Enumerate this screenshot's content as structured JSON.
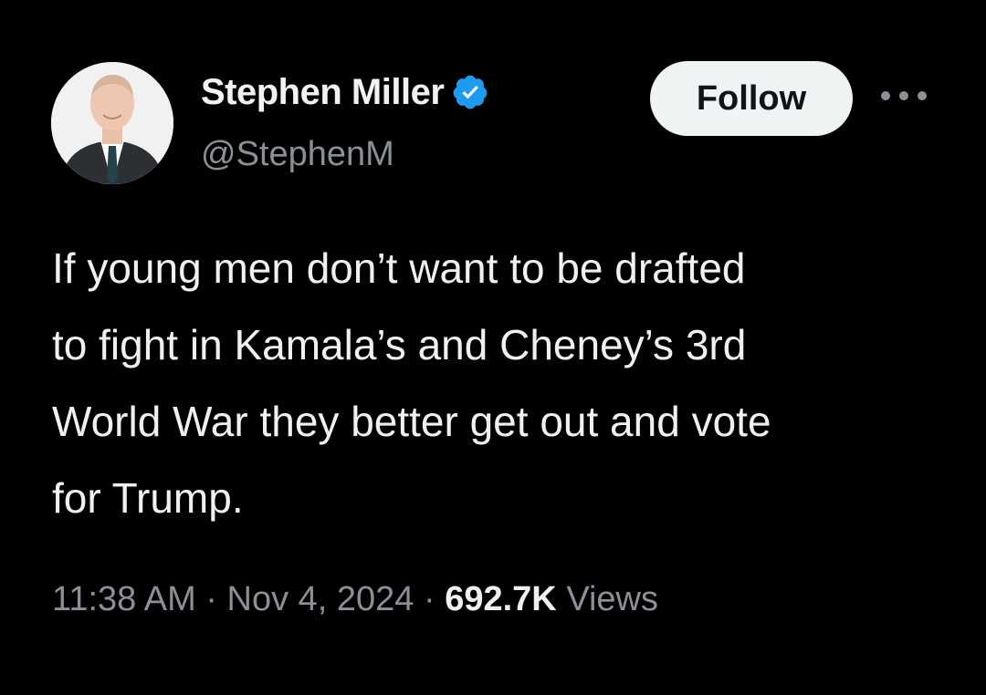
{
  "author": {
    "display_name": "Stephen Miller",
    "handle": "@StephenM",
    "verified": true
  },
  "actions": {
    "follow_label": "Follow",
    "more_icon": "more-horizontal-icon"
  },
  "tweet": {
    "lines": [
      "If young men don’t want to be drafted",
      "to fight in Kamala’s and Cheney’s 3rd",
      "World War they better get out and vote",
      "for Trump."
    ]
  },
  "meta": {
    "time": "11:38 AM",
    "separator": " · ",
    "date": "Nov 4, 2024",
    "views_count": "692.7K",
    "views_label": " Views"
  },
  "colors": {
    "background": "#000000",
    "text_primary": "#f0f0f0",
    "text_secondary": "#8b9096",
    "verified_blue": "#1d9bf0",
    "follow_bg": "#eff3f4"
  }
}
